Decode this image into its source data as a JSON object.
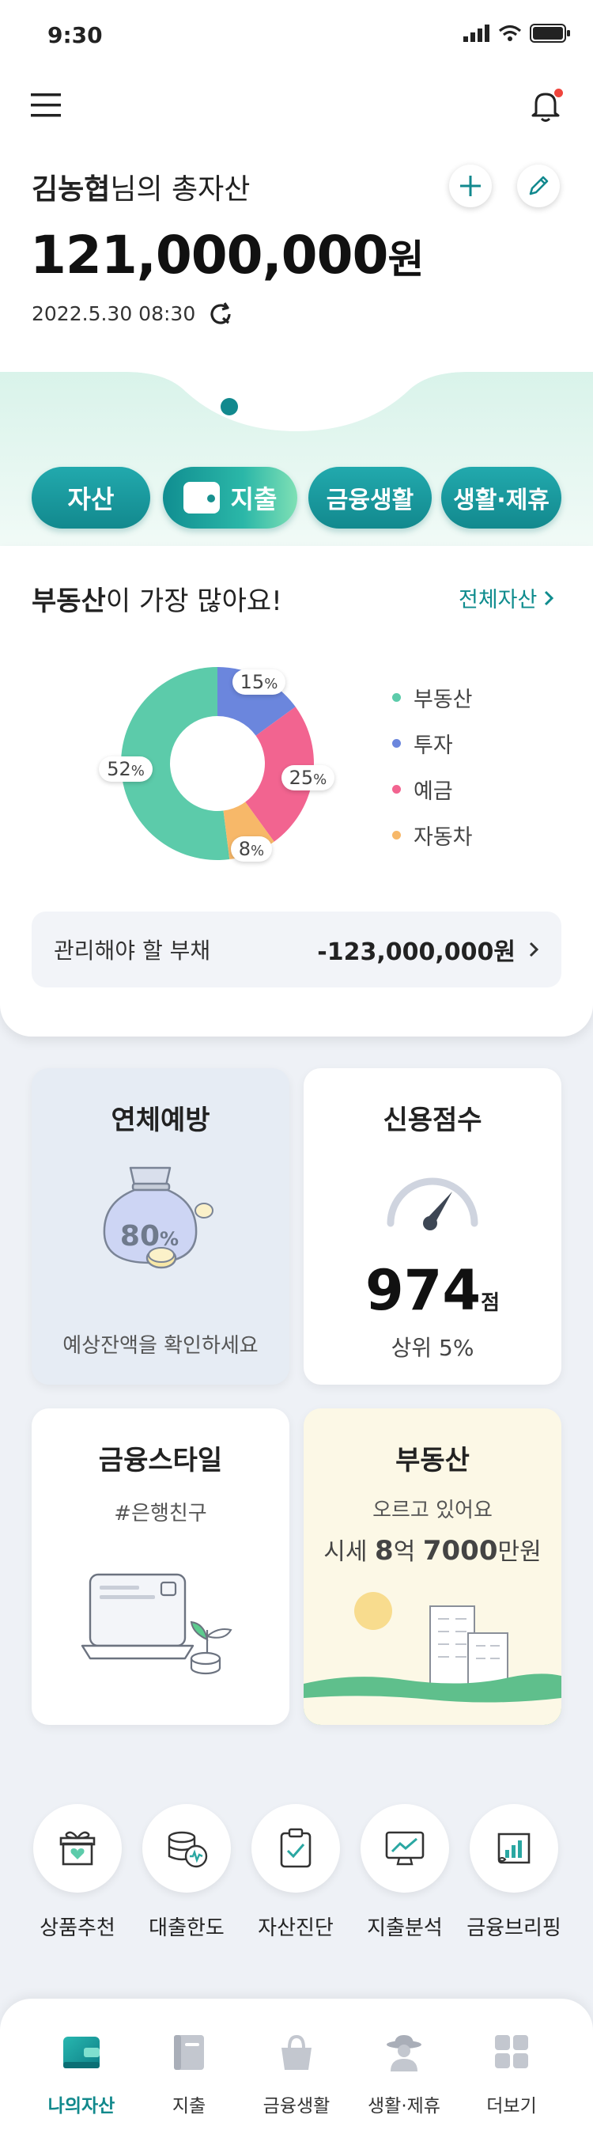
{
  "status_bar": {
    "time": "9:30"
  },
  "header": {
    "user_name": "김농협",
    "suffix": "님의 총자산",
    "total_amount": "121,000,000",
    "unit": "원",
    "datetime": "2022.5.30 08:30"
  },
  "categories": [
    "자산",
    "지출",
    "금융생활",
    "생활·제휴"
  ],
  "asset_summary": {
    "highlight": "부동산",
    "headline_rest": "이 가장 많아요!",
    "all_assets_link": "전체자산"
  },
  "chart_data": {
    "type": "pie",
    "categories": [
      "부동산",
      "투자",
      "예금",
      "자동차"
    ],
    "values": [
      52,
      15,
      25,
      8
    ],
    "colors": [
      "#5ccbaa",
      "#6b86dd",
      "#f26490",
      "#f7b869"
    ],
    "labels": [
      "52",
      "15",
      "25",
      "8"
    ],
    "label_unit": "%"
  },
  "debt": {
    "label": "관리해야 할 부채",
    "value": "-123,000,000원"
  },
  "cards": {
    "overdue": {
      "title": "연체예방",
      "percent": "80",
      "unit": "%",
      "caption": "예상잔액을 확인하세요"
    },
    "credit": {
      "title": "신용점수",
      "score": "974",
      "unit": "점",
      "rank": "상위 5%"
    },
    "style": {
      "title": "금융스타일",
      "tag": "#은행친구"
    },
    "realestate": {
      "title": "부동산",
      "status": "오르고 있어요",
      "price_prefix": "시세",
      "price_a": "8",
      "price_a_unit": "억",
      "price_b": "7000",
      "price_b_unit": "만원"
    }
  },
  "shortcuts": [
    "상품추천",
    "대출한도",
    "자산진단",
    "지출분석",
    "금융브리핑"
  ],
  "tabs": [
    "나의자산",
    "지출",
    "금융생활",
    "생활·제휴",
    "더보기"
  ],
  "colors": {
    "accent": "#12898e",
    "notification": "#f0453d"
  }
}
